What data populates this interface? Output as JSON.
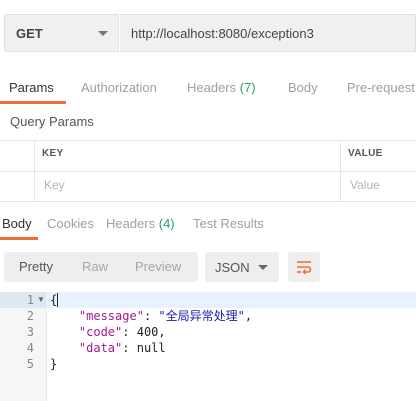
{
  "request": {
    "method": "GET",
    "url": "http://localhost:8080/exception3"
  },
  "request_tabs": [
    {
      "label": "Params",
      "count": ""
    },
    {
      "label": "Authorization",
      "count": ""
    },
    {
      "label": "Headers ",
      "count": "(7)"
    },
    {
      "label": "Body",
      "count": ""
    },
    {
      "label": "Pre-request",
      "count": ""
    }
  ],
  "query_params": {
    "title": "Query Params",
    "columns": [
      "KEY",
      "VALUE"
    ],
    "placeholders": {
      "key": "Key",
      "value": "Value"
    }
  },
  "response_tabs": [
    {
      "label": "Body",
      "count": ""
    },
    {
      "label": "Cookies",
      "count": ""
    },
    {
      "label": "Headers ",
      "count": "(4)"
    },
    {
      "label": "Test Results",
      "count": ""
    }
  ],
  "view_modes": [
    "Pretty",
    "Raw",
    "Preview"
  ],
  "format": "JSON",
  "code": {
    "line_numbers": [
      "1",
      "2",
      "3",
      "4",
      "5"
    ],
    "open_brace": "{",
    "close_brace": "}",
    "fields": [
      {
        "key": "\"message\"",
        "sep": ": ",
        "value": "\"全局异常处理\"",
        "end": ","
      },
      {
        "key": "\"code\"",
        "sep": ": ",
        "value": "400",
        "end": ","
      },
      {
        "key": "\"data\"",
        "sep": ": ",
        "value": "null",
        "end": ""
      }
    ]
  },
  "colors": {
    "accent": "#f26b3a",
    "count_green": "#27a36b",
    "json_key": "#a11a8f",
    "json_string": "#1c1ca8"
  },
  "icons": {
    "method_dropdown": "chevron-down-icon",
    "format_dropdown": "chevron-down-icon",
    "wrap": "wrap-lines-icon",
    "fold": "fold-arrow-icon"
  }
}
